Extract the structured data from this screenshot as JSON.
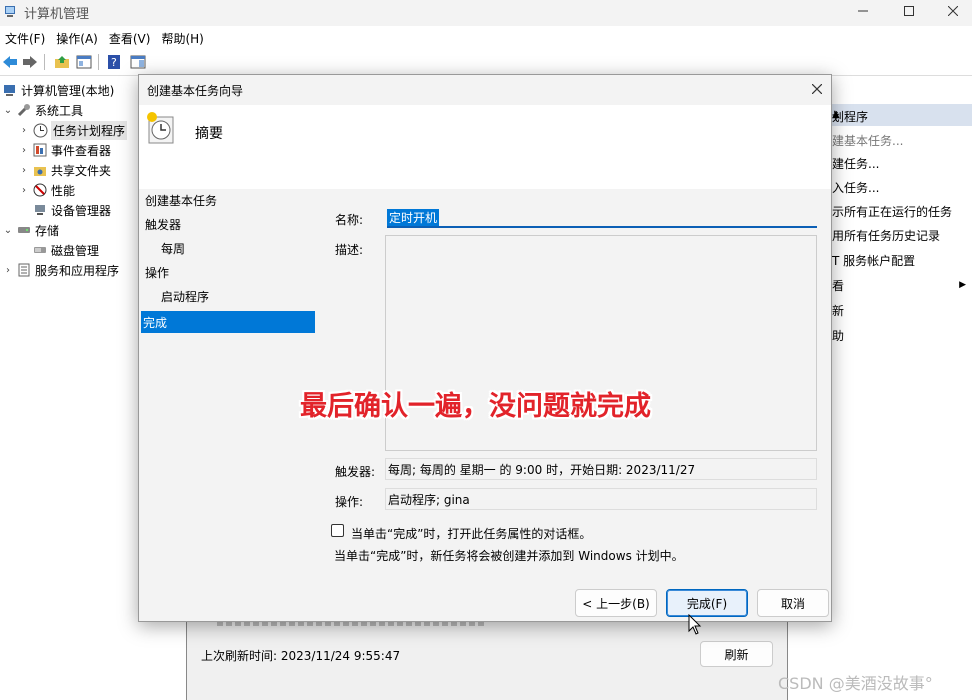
{
  "window": {
    "title": "计算机管理"
  },
  "menu": [
    "文件(F)",
    "操作(A)",
    "查看(V)",
    "帮助(H)"
  ],
  "tree": {
    "root": "计算机管理(本地)",
    "items": [
      {
        "label": "系统工具"
      },
      {
        "label": "任务计划程序"
      },
      {
        "label": "事件查看器"
      },
      {
        "label": "共享文件夹"
      },
      {
        "label": "性能"
      },
      {
        "label": "设备管理器"
      },
      {
        "label": "存储"
      },
      {
        "label": "磁盘管理"
      },
      {
        "label": "服务和应用程序"
      }
    ]
  },
  "actions": {
    "header": "划程序",
    "items": [
      "建基本任务...",
      "建任务...",
      "入任务...",
      "示所有正在运行的任务",
      "用所有任务历史记录",
      "T 服务帐户配置",
      "看",
      "新",
      "助"
    ]
  },
  "background": {
    "last_refresh": "上次刷新时间: 2023/11/24 9:55:47",
    "refresh_button": "刷新"
  },
  "dialog": {
    "title": "创建基本任务向导",
    "header": "摘要",
    "steps": [
      "创建基本任务",
      "触发器",
      "每周",
      "操作",
      "启动程序",
      "完成"
    ],
    "name_label": "名称:",
    "name_value": "定时开机",
    "desc_label": "描述:",
    "trigger_label": "触发器:",
    "trigger_value": "每周; 每周的 星期一 的 9:00 时，开始日期: 2023/11/27",
    "action_label": "操作:",
    "action_value": "启动程序; gina",
    "checkbox_label": "当单击“完成”时，打开此任务属性的对话框。",
    "info_text": "当单击“完成”时，新任务将会被创建并添加到 Windows 计划中。",
    "back_button": "< 上一步(B)",
    "finish_button": "完成(F)",
    "cancel_button": "取消"
  },
  "annotation": "最后确认一遍，没问题就完成",
  "watermark": "CSDN @美酒没故事°"
}
